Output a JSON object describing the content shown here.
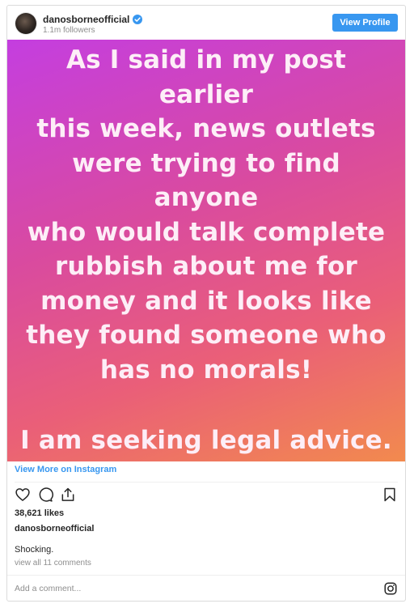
{
  "header": {
    "username": "danosborneofficial",
    "followers": "1.1m followers",
    "view_profile_label": "View Profile"
  },
  "post": {
    "lines": [
      "As I said in my post earlier",
      "this week, news outlets",
      "were trying to find anyone",
      "who would talk complete",
      "rubbish about me for",
      "money and it looks like",
      "they found someone who",
      "has no morals!"
    ],
    "final_line": "I am seeking legal advice.",
    "gradient_start": "#c43ee0",
    "gradient_end": "#f28a4e"
  },
  "view_more_label": "View More on Instagram",
  "likes": "38,621 likes",
  "caption_username": "danosborneofficial",
  "caption": "Shocking.",
  "comments_link": "view all 11 comments",
  "comment_placeholder": "Add a comment...",
  "icons": {
    "like": "heart-icon",
    "comment": "comment-icon",
    "share": "share-icon",
    "save": "bookmark-icon",
    "verified": "verified-badge-icon",
    "brand": "instagram-logo-icon"
  },
  "colors": {
    "accent": "#3897f0",
    "muted": "#8e8e8e"
  }
}
